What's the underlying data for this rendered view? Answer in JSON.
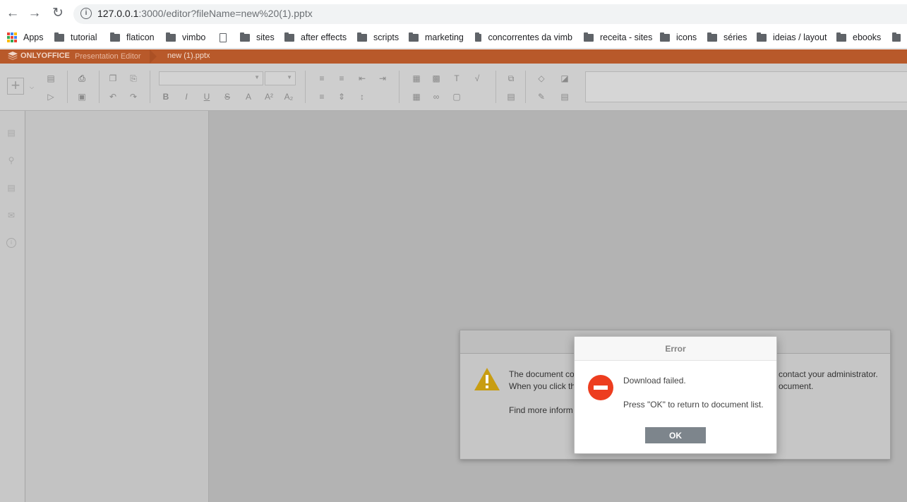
{
  "browser": {
    "url_host": "127.0.0.1",
    "url_rest": ":3000/editor?fileName=new%20(1).pptx",
    "bookmarks": [
      {
        "label": "Apps",
        "icon": "apps-grid-icon"
      },
      {
        "label": "tutorial",
        "icon": "folder-icon"
      },
      {
        "label": "flaticon",
        "icon": "folder-icon"
      },
      {
        "label": "vimbo",
        "icon": "folder-icon"
      },
      {
        "label": "",
        "icon": "page-icon"
      },
      {
        "label": "sites",
        "icon": "folder-icon"
      },
      {
        "label": "after effects",
        "icon": "folder-icon"
      },
      {
        "label": "scripts",
        "icon": "folder-icon"
      },
      {
        "label": "marketing",
        "icon": "folder-icon"
      },
      {
        "label": "concorrentes da vimb",
        "icon": "folder-icon"
      },
      {
        "label": "receita - sites",
        "icon": "folder-icon"
      },
      {
        "label": "icons",
        "icon": "folder-icon"
      },
      {
        "label": "séries",
        "icon": "folder-icon"
      },
      {
        "label": "ideias / layout",
        "icon": "folder-icon"
      },
      {
        "label": "ebooks",
        "icon": "folder-icon"
      }
    ]
  },
  "editor": {
    "brand": "ONLYOFFICE",
    "app_name": "Presentation Editor",
    "doc_title": "new (1).pptx",
    "header_color": "#b8592a"
  },
  "background_dialog": {
    "line1_left": "The document co",
    "line1_right": "contact your administrator.",
    "line2_left": "When you click th",
    "line2_right": "ocument.",
    "line3": "Find more inform"
  },
  "error_dialog": {
    "title": "Error",
    "message": "Download failed.",
    "instruction": "Press \"OK\" to return to document list.",
    "ok_label": "OK",
    "icon": "error-icon",
    "icon_color": "#ed3d1f"
  }
}
